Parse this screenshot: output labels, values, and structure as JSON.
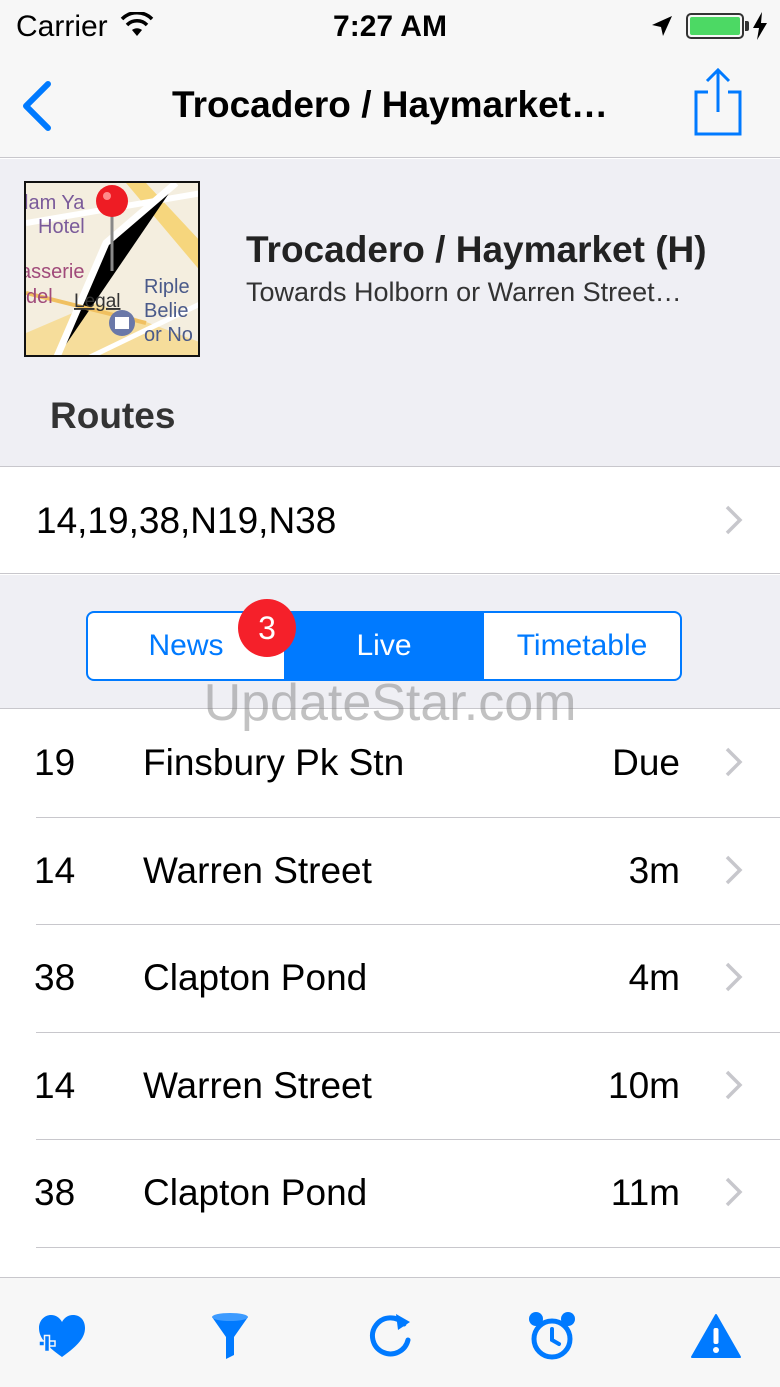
{
  "status_bar": {
    "carrier": "Carrier",
    "time": "7:27 AM"
  },
  "nav": {
    "title": "Trocadero / Haymarket…"
  },
  "stop": {
    "name": "Trocadero / Haymarket (H)",
    "direction": "Towards Holborn or Warren Street…",
    "routes_heading": "Routes",
    "routes": "14,19,38,N19,N38"
  },
  "map": {
    "labels": [
      "lam Ya",
      "Hotel",
      "asserie",
      "del",
      "Legal",
      "Riple",
      "Belie",
      "or No"
    ]
  },
  "segments": {
    "items": [
      {
        "label": "News",
        "active": false
      },
      {
        "label": "Live",
        "active": true
      },
      {
        "label": "Timetable",
        "active": false
      }
    ],
    "news_badge": "3"
  },
  "watermark": "UpdateStar.com",
  "departures": [
    {
      "route": "19",
      "destination": "Finsbury Pk Stn",
      "time": "Due"
    },
    {
      "route": "14",
      "destination": "Warren Street",
      "time": "3m"
    },
    {
      "route": "38",
      "destination": "Clapton Pond",
      "time": "4m"
    },
    {
      "route": "14",
      "destination": "Warren Street",
      "time": "10m"
    },
    {
      "route": "38",
      "destination": "Clapton Pond",
      "time": "11m"
    }
  ],
  "tab_bar": {
    "icons": [
      "heart-plus-icon",
      "filter-icon",
      "refresh-icon",
      "alarm-clock-icon",
      "warning-icon"
    ]
  },
  "colors": {
    "accent": "#007aff",
    "badge": "#f5202a",
    "battery": "#4cd964",
    "group_bg": "#efeff4"
  }
}
